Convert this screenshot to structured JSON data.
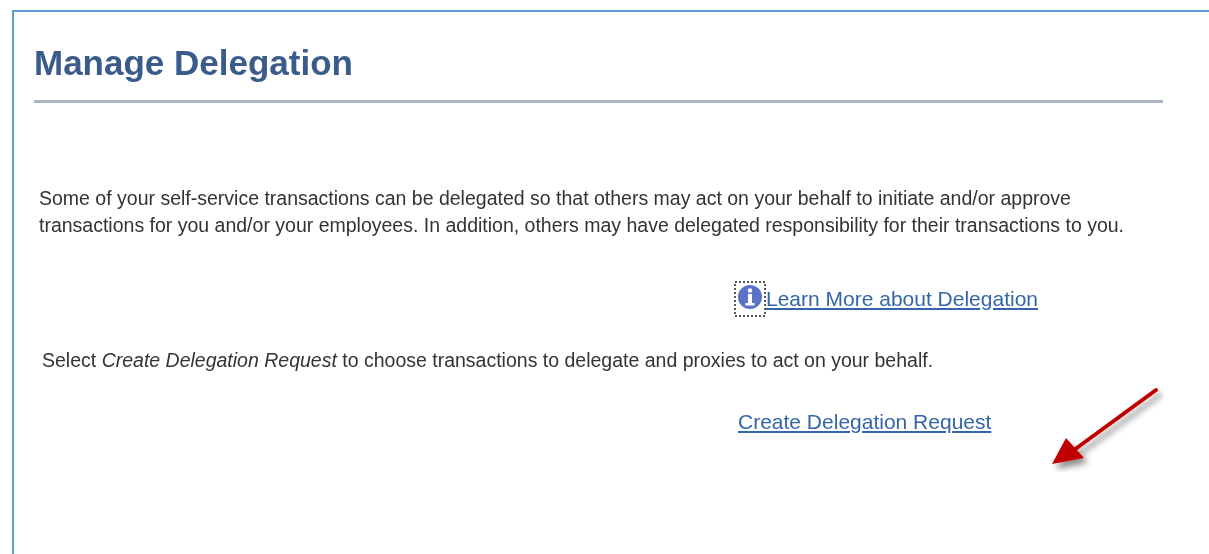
{
  "page": {
    "title": "Manage Delegation"
  },
  "intro": "Some of your self-service transactions can be delegated so that others may act on your behalf to initiate and/or approve transactions for you and/or your employees. In addition, others may have delegated responsibility for their transactions to you.",
  "learn_more_link": "Learn More about Delegation",
  "instruction": "Select *Create Delegation Request* to choose transactions to delegate and proxies to act on your behalf.",
  "create_link": "Create Delegation Request"
}
